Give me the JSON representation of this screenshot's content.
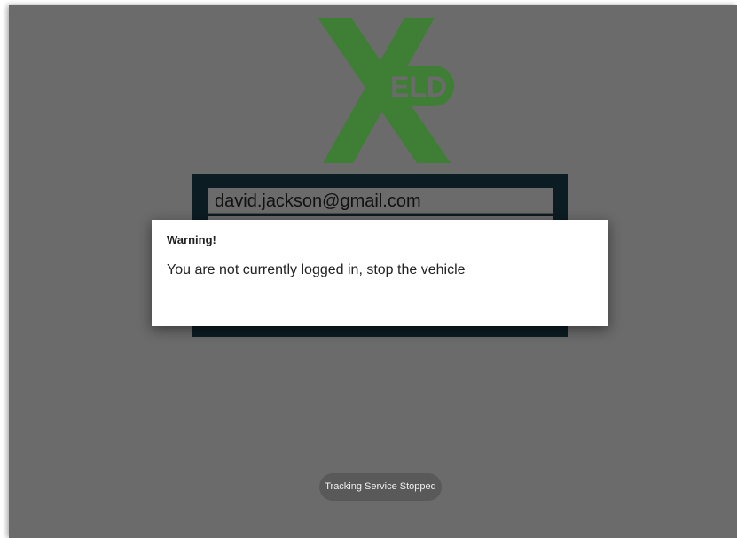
{
  "app": {
    "logo_text": "ELD",
    "logo_letter": "X"
  },
  "login": {
    "email_value": "david.jackson@gmail.com"
  },
  "dialog": {
    "title": "Warning!",
    "message": "You are not currently logged in, stop the vehicle"
  },
  "toast": {
    "text": "Tracking Service Stopped"
  },
  "colors": {
    "brand_green": "#3f7f35",
    "overlay_gray": "#6b6b6b",
    "panel_dark": "#0b1c22"
  }
}
